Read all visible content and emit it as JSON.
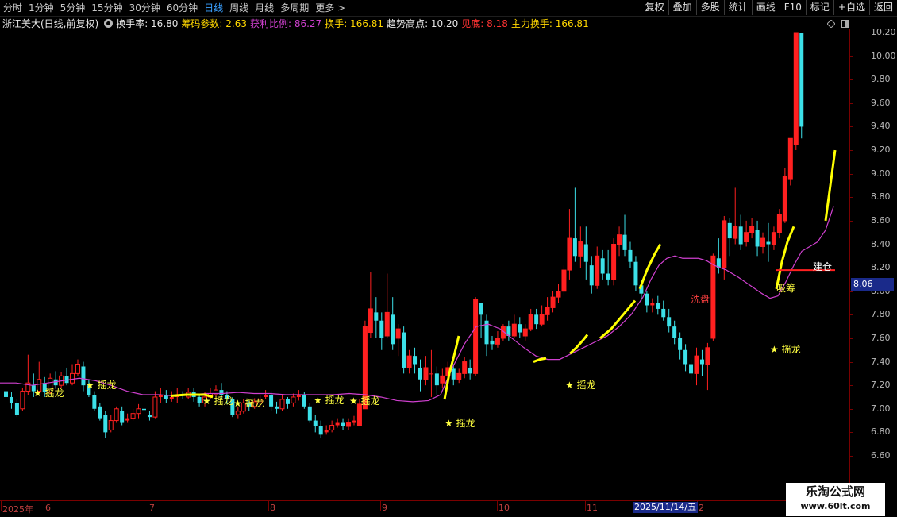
{
  "toolbar": {
    "tabs": [
      "分时",
      "1分钟",
      "5分钟",
      "15分钟",
      "30分钟",
      "60分钟",
      "日线",
      "周线",
      "月线",
      "多周期",
      "更多 >"
    ],
    "active_tab": "日线",
    "right_buttons": [
      "复权",
      "叠加",
      "多股",
      "统计",
      "画线",
      "F10",
      "标记",
      "+自选",
      "返回"
    ]
  },
  "infobar": {
    "stock": "浙江美大(日线,前复权)",
    "items": [
      {
        "label": "换手率: 16.80",
        "color": "#e8e8e8"
      },
      {
        "label": "筹码参数: 2.63",
        "color": "#ffd700"
      },
      {
        "label": "获利比例: 86.27",
        "color": "#d040d0"
      },
      {
        "label": "换手: 166.81",
        "color": "#ffd700"
      },
      {
        "label": "趋势高点: 10.20",
        "color": "#e8e8e8"
      },
      {
        "label": "见底: 8.18",
        "color": "#ff3333"
      },
      {
        "label": "主力换手: 166.81",
        "color": "#ffd700"
      }
    ]
  },
  "yaxis": {
    "labels": [
      "10.20",
      "10.00",
      "9.80",
      "9.60",
      "9.40",
      "9.20",
      "9.00",
      "8.80",
      "8.60",
      "8.40",
      "8.20",
      "8.00",
      "7.80",
      "7.60",
      "7.40",
      "7.20",
      "7.00",
      "6.80",
      "6.60"
    ],
    "current_price": "8.06"
  },
  "xaxis": {
    "labels": [
      "2025年",
      "6",
      "7",
      "8",
      "9",
      "10",
      "11",
      "2"
    ],
    "highlight": "2025/11/14/五"
  },
  "annotations": {
    "yaolong": "★ 摇龙",
    "xipan": "洗盘",
    "xichou": "吸筹",
    "jiancang": "建仓"
  },
  "watermark": {
    "line1": "乐淘公式网",
    "line2": "www.60lt.com"
  },
  "colors": {
    "up": "#ff2020",
    "down": "#3ce0e8",
    "ma": "#d040d0",
    "signal": "#ffff00",
    "bg": "#000000"
  },
  "chart_data": {
    "type": "candlestick",
    "ylim": [
      6.5,
      10.3
    ],
    "candles": [
      [
        7.15,
        7.1,
        7.18,
        7.05
      ],
      [
        7.1,
        7.05,
        7.14,
        7.0
      ],
      [
        7.05,
        6.95,
        7.08,
        6.93
      ],
      [
        7.0,
        7.15,
        7.18,
        6.98
      ],
      [
        7.15,
        7.22,
        7.46,
        7.12
      ],
      [
        7.2,
        7.15,
        7.3,
        7.1
      ],
      [
        7.15,
        7.25,
        7.4,
        7.13
      ],
      [
        7.22,
        7.14,
        7.27,
        7.1
      ],
      [
        7.14,
        7.26,
        7.3,
        7.13
      ],
      [
        7.25,
        7.2,
        7.32,
        7.17
      ],
      [
        7.2,
        7.28,
        7.31,
        7.18
      ],
      [
        7.28,
        7.22,
        7.35,
        7.2
      ],
      [
        7.22,
        7.3,
        7.38,
        7.2
      ],
      [
        7.3,
        7.38,
        7.42,
        7.28
      ],
      [
        7.36,
        7.2,
        7.4,
        7.15
      ],
      [
        7.2,
        7.12,
        7.25,
        7.1
      ],
      [
        7.12,
        7.0,
        7.15,
        6.98
      ],
      [
        7.02,
        6.92,
        7.05,
        6.9
      ],
      [
        6.95,
        6.8,
        6.98,
        6.75
      ],
      [
        6.82,
        6.9,
        6.95,
        6.8
      ],
      [
        6.9,
        7.0,
        7.02,
        6.88
      ],
      [
        6.98,
        6.88,
        7.02,
        6.86
      ],
      [
        6.9,
        6.92,
        6.96,
        6.88
      ],
      [
        6.92,
        6.96,
        7.0,
        6.9
      ],
      [
        6.96,
        7.0,
        7.04,
        6.92
      ],
      [
        7.0,
        6.99,
        7.03,
        6.95
      ],
      [
        6.95,
        6.93,
        6.98,
        6.9
      ],
      [
        6.93,
        7.1,
        7.15,
        6.92
      ],
      [
        7.1,
        7.12,
        7.18,
        7.05
      ],
      [
        7.12,
        7.08,
        7.16,
        7.05
      ],
      [
        7.08,
        7.1,
        7.15,
        7.06
      ],
      [
        7.1,
        7.12,
        7.18,
        7.05
      ],
      [
        7.12,
        7.11,
        7.15,
        7.08
      ],
      [
        7.1,
        7.14,
        7.18,
        7.08
      ],
      [
        7.14,
        7.1,
        7.18,
        7.06
      ],
      [
        7.1,
        7.05,
        7.12,
        7.02
      ],
      [
        7.05,
        7.1,
        7.14,
        7.02
      ],
      [
        7.1,
        7.13,
        7.18,
        7.08
      ],
      [
        7.12,
        7.16,
        7.2,
        7.1
      ],
      [
        7.16,
        7.12,
        7.22,
        7.08
      ],
      [
        7.12,
        7.08,
        7.15,
        7.04
      ],
      [
        7.08,
        6.95,
        7.1,
        6.93
      ],
      [
        6.95,
        6.98,
        7.02,
        6.92
      ],
      [
        6.98,
        7.05,
        7.08,
        6.96
      ],
      [
        7.05,
        7.02,
        7.07,
        6.98
      ],
      [
        7.02,
        7.06,
        7.09,
        7.0
      ],
      [
        7.05,
        7.08,
        7.12,
        7.02
      ],
      [
        7.1,
        7.12,
        7.16,
        7.08
      ],
      [
        7.12,
        7.02,
        7.15,
        6.98
      ],
      [
        7.02,
        7.0,
        7.06,
        6.96
      ],
      [
        7.0,
        7.08,
        7.12,
        6.98
      ],
      [
        7.08,
        7.04,
        7.1,
        7.0
      ],
      [
        7.05,
        7.1,
        7.13,
        7.02
      ],
      [
        7.1,
        7.12,
        7.16,
        7.07
      ],
      [
        7.12,
        7.02,
        7.14,
        7.0
      ],
      [
        7.02,
        6.9,
        7.05,
        6.88
      ],
      [
        6.9,
        6.85,
        6.95,
        6.8
      ],
      [
        6.85,
        6.78,
        6.9,
        6.75
      ],
      [
        6.8,
        6.82,
        6.86,
        6.78
      ],
      [
        6.82,
        6.86,
        6.9,
        6.8
      ],
      [
        6.86,
        6.88,
        6.92,
        6.84
      ],
      [
        6.88,
        6.85,
        6.92,
        6.82
      ],
      [
        6.85,
        6.88,
        6.92,
        6.82
      ],
      [
        6.88,
        6.9,
        6.94,
        6.86
      ],
      [
        6.86,
        7.04,
        7.08,
        6.85
      ],
      [
        7.0,
        7.7,
        7.75,
        7.0
      ],
      [
        7.65,
        7.85,
        8.16,
        7.6
      ],
      [
        7.82,
        7.75,
        7.95,
        7.6
      ],
      [
        7.75,
        7.6,
        7.82,
        7.5
      ],
      [
        7.62,
        7.82,
        8.15,
        7.6
      ],
      [
        7.8,
        7.55,
        7.95,
        7.5
      ],
      [
        7.6,
        7.68,
        7.72,
        7.45
      ],
      [
        7.65,
        7.35,
        7.7,
        7.3
      ],
      [
        7.35,
        7.45,
        7.5,
        7.3
      ],
      [
        7.45,
        7.38,
        7.52,
        7.3
      ],
      [
        7.35,
        7.25,
        7.42,
        7.15
      ],
      [
        7.25,
        7.35,
        7.45,
        7.2
      ],
      [
        7.3,
        7.3,
        7.5,
        7.1
      ],
      [
        7.3,
        7.2,
        7.36,
        7.12
      ],
      [
        7.22,
        7.28,
        7.34,
        7.18
      ],
      [
        7.28,
        7.35,
        7.4,
        7.2
      ],
      [
        7.34,
        7.25,
        7.38,
        7.2
      ],
      [
        7.25,
        7.3,
        7.34,
        7.22
      ],
      [
        7.3,
        7.4,
        7.44,
        7.26
      ],
      [
        7.35,
        7.3,
        7.42,
        7.25
      ],
      [
        7.3,
        7.93,
        7.95,
        7.28
      ],
      [
        7.9,
        7.8,
        7.9,
        7.6
      ],
      [
        7.75,
        7.55,
        7.8,
        7.45
      ],
      [
        7.58,
        7.55,
        7.62,
        7.5
      ],
      [
        7.55,
        7.6,
        7.66,
        7.52
      ],
      [
        7.6,
        7.7,
        7.72,
        7.58
      ],
      [
        7.7,
        7.62,
        7.75,
        7.58
      ],
      [
        7.62,
        7.72,
        7.8,
        7.6
      ],
      [
        7.72,
        7.65,
        7.78,
        7.6
      ],
      [
        7.62,
        7.68,
        7.72,
        7.58
      ],
      [
        7.68,
        7.8,
        7.85,
        7.66
      ],
      [
        7.8,
        7.72,
        7.85,
        7.68
      ],
      [
        7.72,
        7.8,
        7.88,
        7.7
      ],
      [
        7.8,
        7.86,
        7.95,
        7.75
      ],
      [
        7.86,
        7.95,
        8.0,
        7.82
      ],
      [
        7.95,
        8.0,
        8.06,
        7.9
      ],
      [
        8.0,
        8.18,
        8.22,
        7.96
      ],
      [
        8.18,
        8.45,
        8.7,
        8.1
      ],
      [
        8.45,
        8.3,
        8.88,
        8.25
      ],
      [
        8.3,
        8.42,
        8.55,
        8.2
      ],
      [
        8.4,
        8.25,
        8.55,
        8.1
      ],
      [
        8.22,
        8.05,
        8.3,
        7.98
      ],
      [
        8.05,
        8.3,
        8.38,
        8.02
      ],
      [
        8.28,
        8.15,
        8.35,
        8.1
      ],
      [
        8.15,
        8.1,
        8.35,
        8.05
      ],
      [
        8.1,
        8.4,
        8.45,
        8.05
      ],
      [
        8.4,
        8.48,
        8.55,
        8.3
      ],
      [
        8.48,
        8.35,
        8.65,
        8.3
      ],
      [
        8.35,
        8.25,
        8.42,
        8.2
      ],
      [
        8.25,
        8.05,
        8.3,
        8.0
      ],
      [
        8.05,
        7.98,
        8.1,
        7.92
      ],
      [
        7.98,
        7.88,
        8.0,
        7.82
      ],
      [
        7.88,
        7.9,
        7.94,
        7.82
      ],
      [
        7.9,
        7.85,
        7.96,
        7.8
      ],
      [
        7.85,
        7.78,
        7.92,
        7.75
      ],
      [
        7.78,
        7.7,
        7.85,
        7.65
      ],
      [
        7.7,
        7.6,
        7.75,
        7.55
      ],
      [
        7.6,
        7.5,
        7.65,
        7.42
      ],
      [
        7.5,
        7.38,
        7.55,
        7.32
      ],
      [
        7.38,
        7.3,
        7.42,
        7.25
      ],
      [
        7.3,
        7.45,
        7.52,
        7.2
      ],
      [
        7.42,
        7.38,
        7.5,
        7.28
      ],
      [
        7.38,
        7.52,
        7.56,
        7.16
      ],
      [
        7.6,
        8.3,
        8.32,
        7.58
      ],
      [
        8.28,
        8.2,
        8.45,
        8.15
      ],
      [
        8.2,
        8.6,
        8.64,
        8.1
      ],
      [
        8.58,
        8.45,
        8.62,
        8.3
      ],
      [
        8.45,
        8.55,
        8.88,
        8.4
      ],
      [
        8.55,
        8.4,
        8.65,
        8.35
      ],
      [
        8.42,
        8.5,
        8.6,
        8.38
      ],
      [
        8.5,
        8.55,
        8.62,
        8.45
      ],
      [
        8.52,
        8.38,
        8.6,
        8.3
      ],
      [
        8.38,
        8.45,
        8.5,
        8.32
      ],
      [
        8.42,
        8.4,
        8.58,
        8.25
      ],
      [
        8.4,
        8.5,
        8.55,
        8.35
      ],
      [
        8.5,
        8.65,
        8.7,
        8.45
      ],
      [
        8.6,
        8.98,
        9.05,
        8.58
      ],
      [
        8.95,
        9.3,
        9.3,
        8.9
      ],
      [
        9.25,
        10.2,
        10.2,
        9.2
      ],
      [
        10.2,
        9.4,
        10.2,
        9.3
      ]
    ],
    "ma_line": [
      [
        0,
        7.22
      ],
      [
        20,
        7.22
      ],
      [
        40,
        7.2
      ],
      [
        60,
        7.22
      ],
      [
        80,
        7.24
      ],
      [
        100,
        7.26
      ],
      [
        120,
        7.24
      ],
      [
        140,
        7.2
      ],
      [
        160,
        7.15
      ],
      [
        180,
        7.12
      ],
      [
        200,
        7.12
      ],
      [
        220,
        7.11
      ],
      [
        240,
        7.12
      ],
      [
        260,
        7.13
      ],
      [
        280,
        7.13
      ],
      [
        300,
        7.14
      ],
      [
        320,
        7.13
      ],
      [
        340,
        7.13
      ],
      [
        360,
        7.12
      ],
      [
        380,
        7.12
      ],
      [
        400,
        7.12
      ],
      [
        420,
        7.12
      ],
      [
        440,
        7.13
      ],
      [
        460,
        7.12
      ],
      [
        480,
        7.1
      ],
      [
        500,
        7.07
      ],
      [
        520,
        7.06
      ],
      [
        540,
        7.07
      ],
      [
        555,
        7.12
      ],
      [
        570,
        7.35
      ],
      [
        585,
        7.55
      ],
      [
        600,
        7.7
      ],
      [
        615,
        7.72
      ],
      [
        630,
        7.68
      ],
      [
        645,
        7.6
      ],
      [
        660,
        7.52
      ],
      [
        675,
        7.45
      ],
      [
        690,
        7.42
      ],
      [
        705,
        7.42
      ],
      [
        720,
        7.47
      ],
      [
        735,
        7.52
      ],
      [
        750,
        7.57
      ],
      [
        765,
        7.62
      ],
      [
        780,
        7.7
      ],
      [
        795,
        7.8
      ],
      [
        810,
        7.95
      ],
      [
        820,
        8.1
      ],
      [
        830,
        8.22
      ],
      [
        840,
        8.28
      ],
      [
        850,
        8.3
      ],
      [
        860,
        8.28
      ],
      [
        870,
        8.28
      ],
      [
        880,
        8.28
      ],
      [
        890,
        8.26
      ],
      [
        900,
        8.22
      ],
      [
        915,
        8.18
      ],
      [
        930,
        8.12
      ],
      [
        945,
        8.05
      ],
      [
        960,
        7.98
      ],
      [
        970,
        7.94
      ],
      [
        980,
        7.96
      ],
      [
        990,
        8.08
      ],
      [
        1000,
        8.22
      ],
      [
        1010,
        8.34
      ],
      [
        1020,
        8.38
      ],
      [
        1030,
        8.42
      ],
      [
        1040,
        8.52
      ],
      [
        1050,
        8.72
      ]
    ],
    "signal_segments": [
      [
        [
          215,
          7.11
        ],
        [
          235,
          7.12
        ],
        [
          258,
          7.12
        ],
        [
          268,
          7.1
        ]
      ],
      [
        [
          560,
          7.08
        ],
        [
          566,
          7.3
        ],
        [
          572,
          7.45
        ],
        [
          578,
          7.62
        ]
      ],
      [
        [
          672,
          7.4
        ],
        [
          680,
          7.42
        ],
        [
          688,
          7.43
        ]
      ],
      [
        [
          718,
          7.47
        ],
        [
          726,
          7.52
        ],
        [
          734,
          7.58
        ],
        [
          740,
          7.63
        ]
      ],
      [
        [
          756,
          7.6
        ],
        [
          770,
          7.68
        ],
        [
          785,
          7.8
        ],
        [
          800,
          7.92
        ]
      ],
      [
        [
          806,
          8.02
        ],
        [
          815,
          8.18
        ],
        [
          825,
          8.32
        ],
        [
          832,
          8.4
        ]
      ],
      [
        [
          978,
          8.02
        ],
        [
          985,
          8.25
        ],
        [
          992,
          8.42
        ],
        [
          1000,
          8.55
        ]
      ],
      [
        [
          1040,
          8.6
        ],
        [
          1044,
          8.8
        ],
        [
          1048,
          9.0
        ],
        [
          1052,
          9.2
        ]
      ]
    ],
    "support_line": {
      "x1": 978,
      "x2": 1052,
      "y": 8.18
    }
  }
}
